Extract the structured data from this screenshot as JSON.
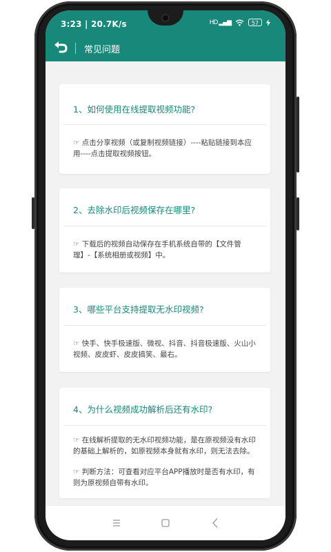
{
  "status_bar": {
    "time": "3:23 | 20.7K/s",
    "signal": "HD ▂▄▆",
    "battery": "57"
  },
  "app_bar": {
    "title": "常见问题"
  },
  "faq": [
    {
      "question": "1、如何使用在线提取视频功能?",
      "answers": [
        "☞ 点击分享视频（或复制视频链接）----粘贴链接到本应用----点击提取视频按钮。"
      ]
    },
    {
      "question": "2、去除水印后视频保存在哪里?",
      "answers": [
        "☞ 下载后的视频自动保存在手机系统自带的【文件管理】-【系统相册或视频】中。"
      ]
    },
    {
      "question": "3、哪些平台支持提取无水印视频?",
      "answers": [
        "☞ 快手、快手极速版、微视、抖音、抖音极速版、火山小视频、皮皮虾、皮皮搞笑、最右。"
      ]
    },
    {
      "question": "4、为什么视频成功解析后还有水印?",
      "answers": [
        "☞ 在线解析提取的无水印视频功能，是在原视频没有水印的基础上解析的，如原视频本身就有水印，则无法去除。",
        "☞ 判断方法：可查看对应平台APP播放时是否有水印，有则为原视频自带有水印。"
      ]
    }
  ],
  "icons": {
    "back": "back-arrow-icon",
    "menu": "menu-icon",
    "home": "home-icon",
    "nav_back": "nav-back-icon"
  },
  "colors": {
    "accent": "#17887a",
    "background": "#f2f2f2"
  }
}
